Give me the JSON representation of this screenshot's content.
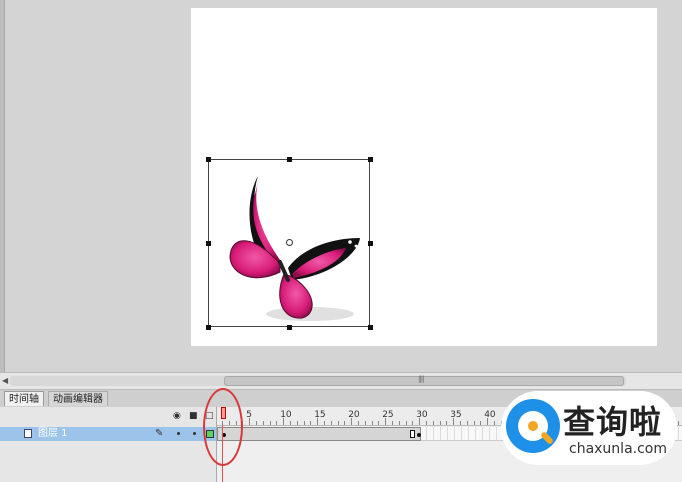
{
  "tabs": {
    "timeline": "时间轴",
    "motion_editor": "动画编辑器"
  },
  "layers": [
    {
      "name": "图层 1"
    }
  ],
  "ruler": {
    "labels": [
      "5",
      "10",
      "15",
      "20",
      "25",
      "30",
      "35",
      "40"
    ]
  },
  "current_frame": 1,
  "keyframe_span_end": 30,
  "icons": {
    "eye": "eye-icon",
    "lock": "lock-icon",
    "outline": "outline-square-icon",
    "layer": "layer-icon",
    "pencil": "pencil-icon"
  },
  "colors": {
    "layer_selected": "#9cc3ea",
    "keyframe": "#5bd25b",
    "playhead": "#ff9a9a",
    "annotation": "#d93838",
    "butterfly": "#d81b78",
    "watermark_blue": "#1e90e8",
    "watermark_orange": "#f5a623"
  },
  "watermark": {
    "title": "查询啦",
    "url": "chaxunla.com"
  }
}
